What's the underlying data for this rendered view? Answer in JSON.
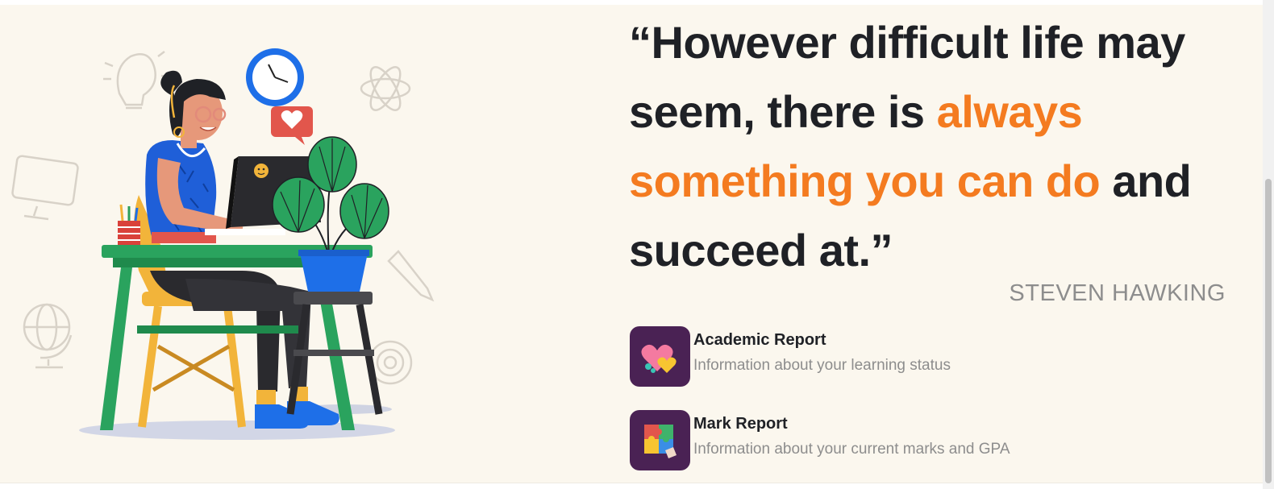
{
  "quote": {
    "open": "“However difficult life may seem, there is ",
    "highlight": "always something you can do",
    "close": " and succeed at.”",
    "highlight_color": "#f47b20",
    "text_color": "#1f2126"
  },
  "author": "STEVEN HAWKING",
  "reports": [
    {
      "title": "Academic Report",
      "description": "Information about your learning status",
      "icon": "hearts-icon"
    },
    {
      "title": "Mark Report",
      "description": "Information about your current marks and GPA",
      "icon": "puzzle-icon"
    }
  ],
  "colors": {
    "background": "#fbf7ee",
    "tile": "#4a2254",
    "muted": "#8d8d8d"
  },
  "illustration": "woman-working-at-desk-illustration"
}
